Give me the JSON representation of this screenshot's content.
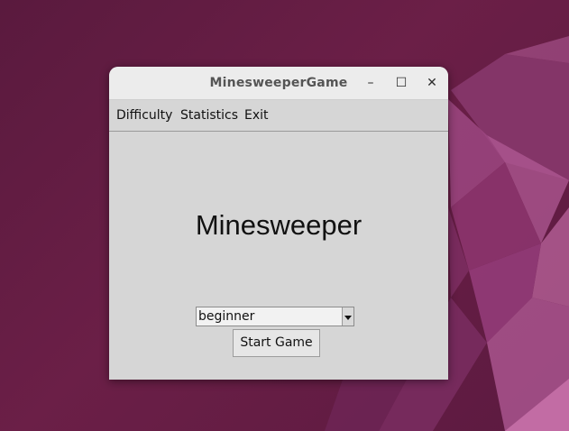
{
  "window": {
    "title": "MinesweeperGame",
    "controls": {
      "minimize": "–",
      "maximize": "☐",
      "close": "✕"
    }
  },
  "menubar": {
    "items": [
      {
        "label": "Difficulty"
      },
      {
        "label": "Statistics"
      },
      {
        "label": "Exit"
      }
    ]
  },
  "main": {
    "heading": "Minesweeper",
    "difficulty_select": {
      "selected": "beginner"
    },
    "start_button_label": "Start Game"
  },
  "colors": {
    "window_bg": "#d6d6d6",
    "titlebar_bg": "#ececec",
    "desktop_bg": "#5c1a40"
  }
}
